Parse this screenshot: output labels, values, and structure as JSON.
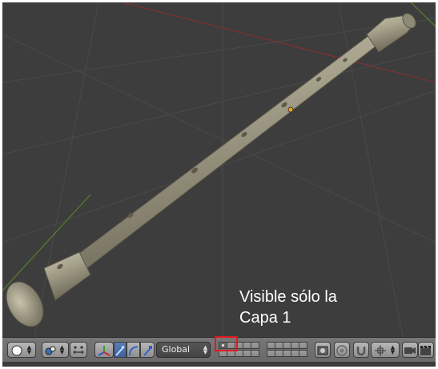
{
  "viewport": {
    "object": "recorder-flute",
    "annotation": {
      "line1": "Visible sólo la",
      "line2": "Capa 1"
    }
  },
  "header": {
    "viewport_shade": {
      "icon": "solid-sphere-icon"
    },
    "pivot_point": {
      "icon": "pivot-point-icon"
    },
    "manipulator_toggle": {
      "icon": "manipulator-axes-icon"
    },
    "manipulator_modes": [
      "translate-icon",
      "rotate-icon",
      "scale-icon"
    ],
    "orientation": {
      "selected": "Global"
    },
    "layers": {
      "first_group": {
        "count": 10,
        "active": [
          1
        ]
      },
      "second_group": {
        "count": 10,
        "active": []
      },
      "highlighted": "layer-1"
    },
    "lock_icon": "lock-camera-icon",
    "proportional_edit_icon": "proportional-edit-icon",
    "snap_icon": "magnet-icon",
    "snap_element_icon": "snap-increment-icon",
    "render_icons": [
      "opengl-render-icon",
      "opengl-animation-icon"
    ]
  },
  "colors": {
    "viewport_bg": "#3d3d3d",
    "header_bg": "#727272",
    "highlight": "#e0191e",
    "object": "#a9a48e",
    "x_axis": "#8b2e2e",
    "y_axis": "#5a8a2a"
  }
}
